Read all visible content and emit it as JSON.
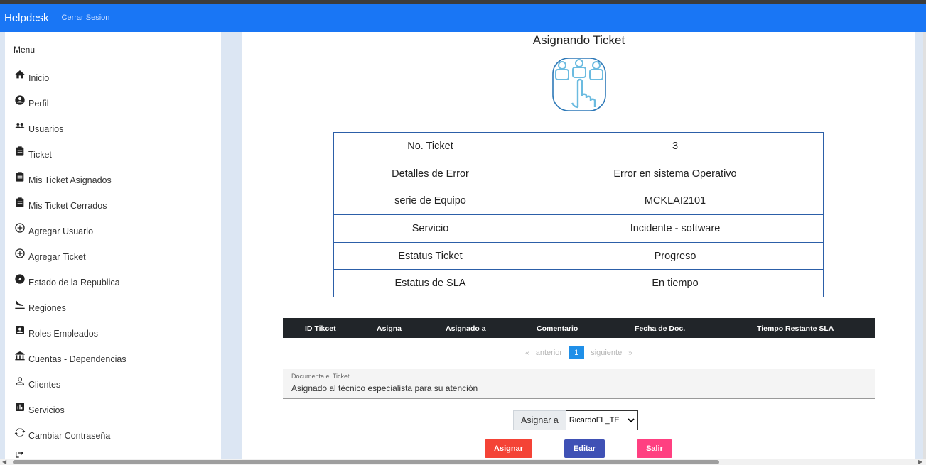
{
  "navbar": {
    "brand": "Helpdesk",
    "logout": "Cerrar Sesion"
  },
  "sidebar": {
    "title": "Menu",
    "items": [
      {
        "label": "Inicio",
        "icon": "home-icon"
      },
      {
        "label": "Perfil",
        "icon": "account-circle-icon"
      },
      {
        "label": "Usuarios",
        "icon": "people-icon"
      },
      {
        "label": "Ticket",
        "icon": "clipboard-icon"
      },
      {
        "label": "Mis Ticket Asignados",
        "icon": "clipboard-icon"
      },
      {
        "label": "Mis Ticket Cerrados",
        "icon": "clipboard-icon"
      },
      {
        "label": "Agregar Usuario",
        "icon": "add-circle-icon"
      },
      {
        "label": "Agregar Ticket",
        "icon": "add-circle-icon"
      },
      {
        "label": "Estado de la Republica",
        "icon": "compass-icon"
      },
      {
        "label": "Regiones",
        "icon": "flight-land-icon"
      },
      {
        "label": "Roles Empleados",
        "icon": "badge-icon"
      },
      {
        "label": "Cuentas - Dependencias",
        "icon": "bank-icon"
      },
      {
        "label": "Clientes",
        "icon": "person-outline-icon"
      },
      {
        "label": "Servicios",
        "icon": "bar-chart-icon"
      },
      {
        "label": "Cambiar Contraseña",
        "icon": "sync-icon"
      }
    ]
  },
  "main": {
    "title": "Asignando Ticket",
    "info_rows": [
      {
        "label": "No. Ticket",
        "value": "3"
      },
      {
        "label": "Detalles de Error",
        "value": "Error en sistema Operativo"
      },
      {
        "label": "serie de Equipo",
        "value": "MCKLAI2101"
      },
      {
        "label": "Servicio",
        "value": "Incidente - software"
      },
      {
        "label": "Estatus Ticket",
        "value": "Progreso"
      },
      {
        "label": "Estatus de SLA",
        "value": "En tiempo"
      }
    ],
    "history_table": {
      "headers": [
        "ID Tikcet",
        "Asigna",
        "Asignado a",
        "Comentario",
        "Fecha de Doc.",
        "Tiempo Restante SLA"
      ]
    },
    "pagination": {
      "first": "«",
      "prev": "anterior",
      "current": "1",
      "next": "siguiente",
      "last": "»"
    },
    "document_field": {
      "label": "Documenta el Ticket",
      "value": "Asignado al técnico especialista para su atención"
    },
    "assign": {
      "label": "Asignar a",
      "selected": "RicardoFL_TE"
    },
    "buttons": {
      "assign": "Asignar",
      "edit": "Editar",
      "exit": "Salir"
    },
    "colors": {
      "assign": "#f44336",
      "edit": "#3f51b5",
      "exit": "#ff4081",
      "navbar": "#1976f5"
    }
  }
}
